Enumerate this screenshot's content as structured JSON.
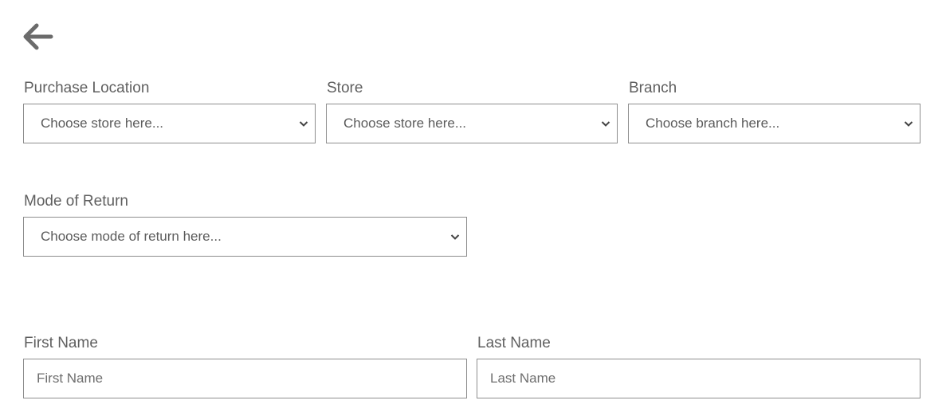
{
  "back": {
    "icon": "arrow-left-icon"
  },
  "purchase_location": {
    "label": "Purchase Location",
    "selected": "Choose store here..."
  },
  "store": {
    "label": "Store",
    "selected": "Choose store here..."
  },
  "branch": {
    "label": "Branch",
    "selected": "Choose branch here..."
  },
  "mode_of_return": {
    "label": "Mode of Return",
    "selected": "Choose mode of return here..."
  },
  "first_name": {
    "label": "First Name",
    "placeholder": "First Name",
    "value": ""
  },
  "last_name": {
    "label": "Last Name",
    "placeholder": "Last Name",
    "value": ""
  },
  "colors": {
    "text": "#5b5b5b",
    "border": "#8e8e8e",
    "icon": "#6b6b6b"
  }
}
